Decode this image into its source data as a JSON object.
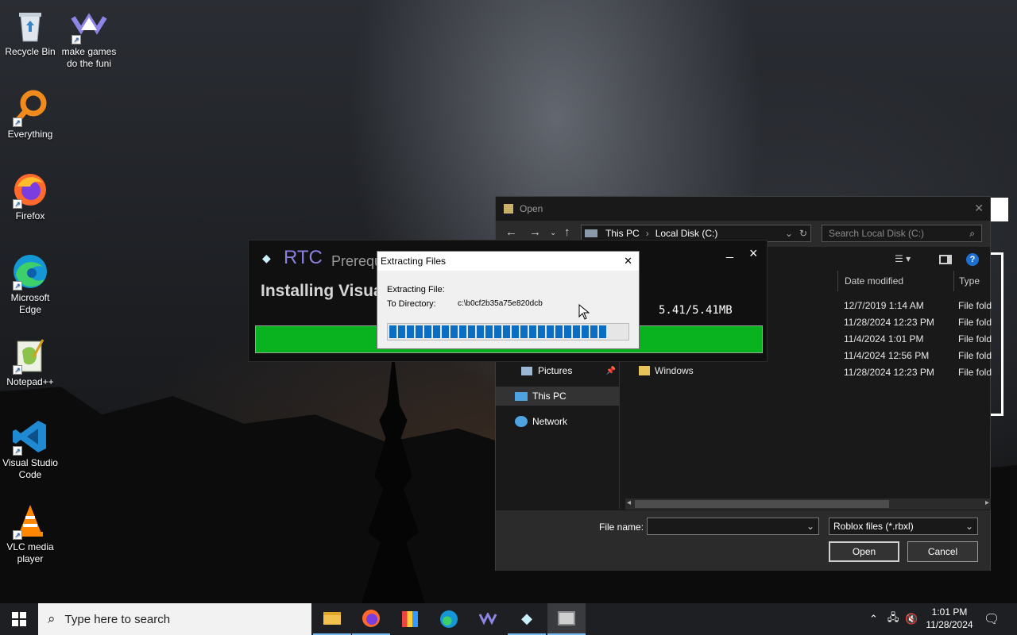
{
  "desktop": {
    "icons": [
      {
        "label": "Recycle Bin",
        "icon": "recycle-bin-icon"
      },
      {
        "label": "make games do the funi",
        "icon": "game-engine-icon"
      },
      {
        "label": "Everything",
        "icon": "everything-search-icon"
      },
      {
        "label": "Firefox",
        "icon": "firefox-icon"
      },
      {
        "label": "Microsoft Edge",
        "icon": "edge-icon"
      },
      {
        "label": "Notepad++",
        "icon": "notepadpp-icon"
      },
      {
        "label": "Visual Studio Code",
        "icon": "vscode-icon"
      },
      {
        "label": "VLC media player",
        "icon": "vlc-icon"
      }
    ]
  },
  "open_dialog": {
    "title": "Open",
    "breadcrumb": [
      "This PC",
      "Local Disk (C:)"
    ],
    "search_placeholder": "Search Local Disk (C:)",
    "columns": {
      "date": "Date modified",
      "type": "Type"
    },
    "rows": [
      {
        "name": "",
        "date": "12/7/2019 1:14 AM",
        "type": "File fold"
      },
      {
        "name": "",
        "date": "11/28/2024 12:23 PM",
        "type": "File fold"
      },
      {
        "name": "",
        "date": "11/4/2024 1:01 PM",
        "type": "File fold"
      },
      {
        "name": "",
        "date": "11/4/2024 12:56 PM",
        "type": "File fold"
      },
      {
        "name": "Windows",
        "date": "11/28/2024 12:23 PM",
        "type": "File fold"
      }
    ],
    "nav": {
      "pictures": "Pictures",
      "this_pc": "This PC",
      "network": "Network"
    },
    "file_name_label": "File name:",
    "file_name_value": "",
    "filter": "Roblox files (*.rbxl)",
    "open_label": "Open",
    "cancel_label": "Cancel"
  },
  "rtc": {
    "brand": "RTC",
    "subtitle": "Prerequ",
    "status": "Installing Visua",
    "size": "5.41/5.41MB",
    "progress": 1.0,
    "min_label": "_",
    "close_label": "×"
  },
  "extract": {
    "title": "Extracting Files",
    "file_label": "Extracting File:",
    "dir_label": "To Directory:",
    "dir_value": "c:\\b0cf2b35a75e820dcb",
    "segments": 25,
    "progress": 1.0,
    "close_label": "✕"
  },
  "taskbar": {
    "search_placeholder": "Type here to search",
    "time": "1:01 PM",
    "date": "11/28/2024"
  },
  "colors": {
    "rtc_green": "#09b31f",
    "extract_blue": "#0a6fc2",
    "rtc_purple": "#8a80e0"
  }
}
